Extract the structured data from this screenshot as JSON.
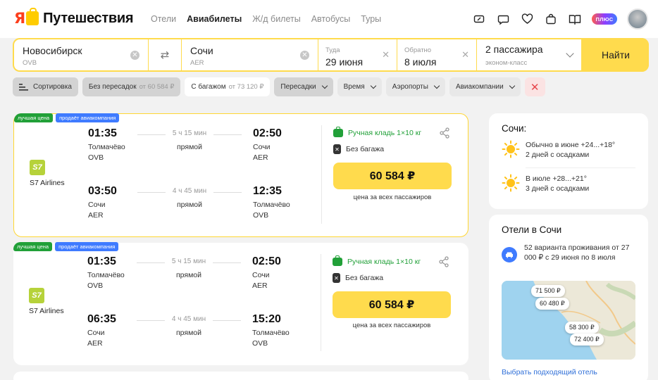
{
  "header": {
    "logo_ya": "Я",
    "logo_text": "Путешествия",
    "nav": [
      {
        "label": "Отели",
        "active": false
      },
      {
        "label": "Авиабилеты",
        "active": true
      },
      {
        "label": "Ж/д билеты",
        "active": false
      },
      {
        "label": "Автобусы",
        "active": false
      },
      {
        "label": "Туры",
        "active": false
      }
    ],
    "plus_label": "ПЛЮС",
    "icons": [
      "ticket-icon",
      "chat-icon",
      "heart-icon",
      "bag-icon",
      "book-icon"
    ]
  },
  "search": {
    "from_city": "Новосибирск",
    "from_code": "OVB",
    "to_city": "Сочи",
    "to_code": "AER",
    "there_label": "Туда",
    "there_date": "29 июня",
    "back_label": "Обратно",
    "back_date": "8 июля",
    "passengers": "2 пассажира",
    "class": "эконом-класс",
    "find_label": "Найти",
    "accent": "#ffdb4d"
  },
  "filters": {
    "sort": "Сортировка",
    "nonstop": "Без пересадок",
    "nonstop_price": "от 60 584 ₽",
    "baggage": "С багажом",
    "baggage_price": "от 73 120 ₽",
    "transfers": "Пересадки",
    "time": "Время",
    "airports": "Аэропорты",
    "airlines": "Авиакомпании"
  },
  "tickets": [
    {
      "badge_best": "лучшая цена",
      "badge_airline": "продаёт авиакомпания",
      "airline": "S7 Airlines",
      "airline_logo": "S7",
      "out": {
        "dep_time": "01:35",
        "dep_place": "Толмачёво",
        "dep_code": "OVB",
        "duration": "5 ч 15 мин",
        "direct": "прямой",
        "arr_time": "02:50",
        "arr_place": "Сочи",
        "arr_code": "AER"
      },
      "back": {
        "dep_time": "03:50",
        "dep_place": "Сочи",
        "dep_code": "AER",
        "duration": "4 ч 45 мин",
        "direct": "прямой",
        "arr_time": "12:35",
        "arr_place": "Толмачёво",
        "arr_code": "OVB"
      },
      "carry_on": "Ручная кладь 1×10 кг",
      "no_baggage": "Без багажа",
      "price": "60 584 ₽",
      "price_note": "цена за всех пассажиров"
    },
    {
      "badge_best": "лучшая цена",
      "badge_airline": "продаёт авиакомпания",
      "airline": "S7 Airlines",
      "airline_logo": "S7",
      "out": {
        "dep_time": "01:35",
        "dep_place": "Толмачёво",
        "dep_code": "OVB",
        "duration": "5 ч 15 мин",
        "direct": "прямой",
        "arr_time": "02:50",
        "arr_place": "Сочи",
        "arr_code": "AER"
      },
      "back": {
        "dep_time": "06:35",
        "dep_place": "Сочи",
        "dep_code": "AER",
        "duration": "4 ч 45 мин",
        "direct": "прямой",
        "arr_time": "15:20",
        "arr_place": "Толмачёво",
        "arr_code": "OVB"
      },
      "carry_on": "Ручная кладь 1×10 кг",
      "no_baggage": "Без багажа",
      "price": "60 584 ₽",
      "price_note": "цена за всех пассажиров"
    }
  ],
  "weather": {
    "title": "Сочи:",
    "items": [
      {
        "line1": "Обычно в июне +24...+18°",
        "line2": "2 дней с осадками"
      },
      {
        "line1": "В июле +28...+21°",
        "line2": "3 дней с осадками"
      }
    ]
  },
  "hotels": {
    "title": "Отели в Сочи",
    "text": "52 варианта проживания от 27 000 ₽ с 29 июня по 8 июля",
    "pins": [
      "71 500 ₽",
      "60 480 ₽",
      "58 300 ₽",
      "72 400 ₽"
    ],
    "link": "Выбрать подходящий отель"
  }
}
